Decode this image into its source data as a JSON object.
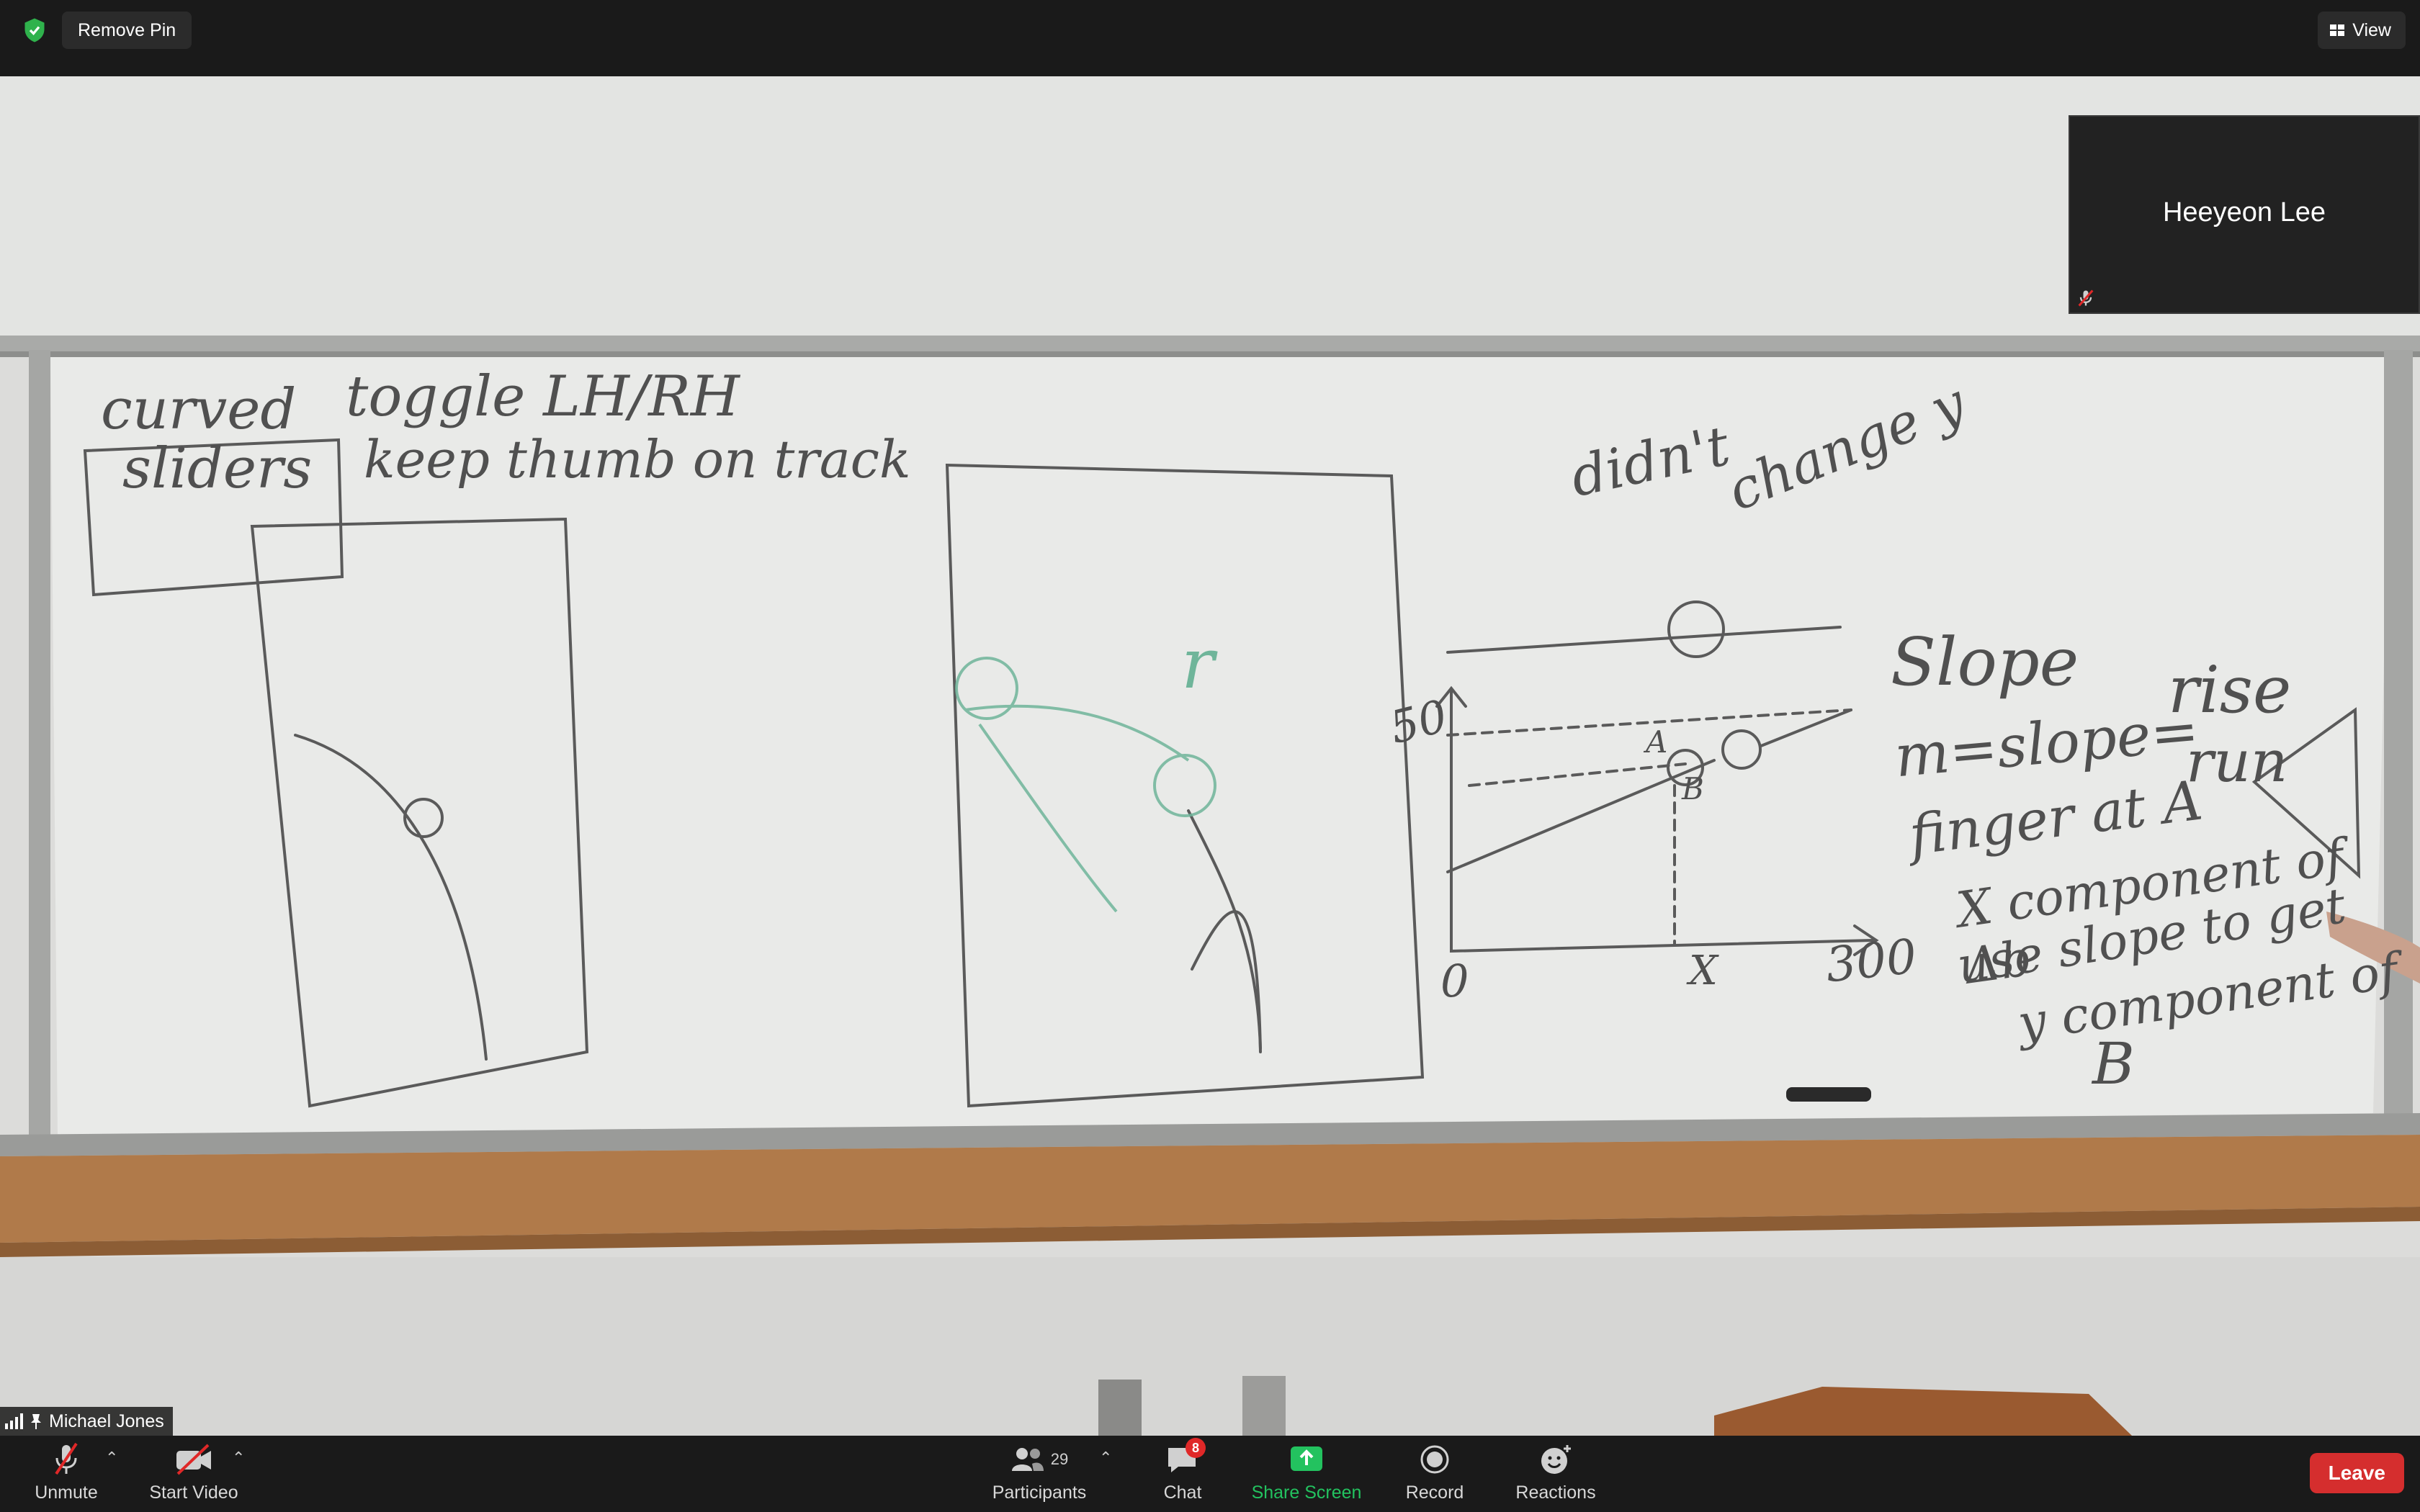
{
  "top_bar": {
    "remove_pin_label": "Remove Pin",
    "view_label": "View"
  },
  "pinned_tile": {
    "participant_name": "Heeyeon Lee"
  },
  "active_speaker": {
    "name": "Michael Jones"
  },
  "whiteboard": {
    "box_label_1": "curved",
    "box_label_2": "sliders",
    "note_1": "toggle LH/RH",
    "note_2": "keep thumb on track",
    "graph_top_note_1": "didn't",
    "graph_top_note_2": "change y",
    "graph_y_tick": "50",
    "graph_origin": "0",
    "graph_x_label": "X",
    "graph_x_max": "300",
    "graph_point_a": "A",
    "graph_point_b": "B",
    "letter_r": "r",
    "slope_title": "Slope",
    "slope_formula_left": "m=slope=",
    "slope_rise": "rise",
    "slope_run": "run",
    "slope_line_3": "finger at A",
    "slope_line_4": "X component of Δb",
    "slope_line_5": "use slope to get",
    "slope_line_6": "y component of",
    "slope_line_7": "B"
  },
  "bottom_bar": {
    "unmute_label": "Unmute",
    "start_video_label": "Start Video",
    "participants_label": "Participants",
    "participants_count": "29",
    "chat_label": "Chat",
    "chat_badge": "8",
    "share_screen_label": "Share Screen",
    "record_label": "Record",
    "reactions_label": "Reactions",
    "leave_label": "Leave"
  },
  "colors": {
    "bar_background": "#1a1a1a",
    "leave_red": "#d52e2e",
    "share_green": "#23c25f",
    "shield_green": "#2fb24c"
  }
}
